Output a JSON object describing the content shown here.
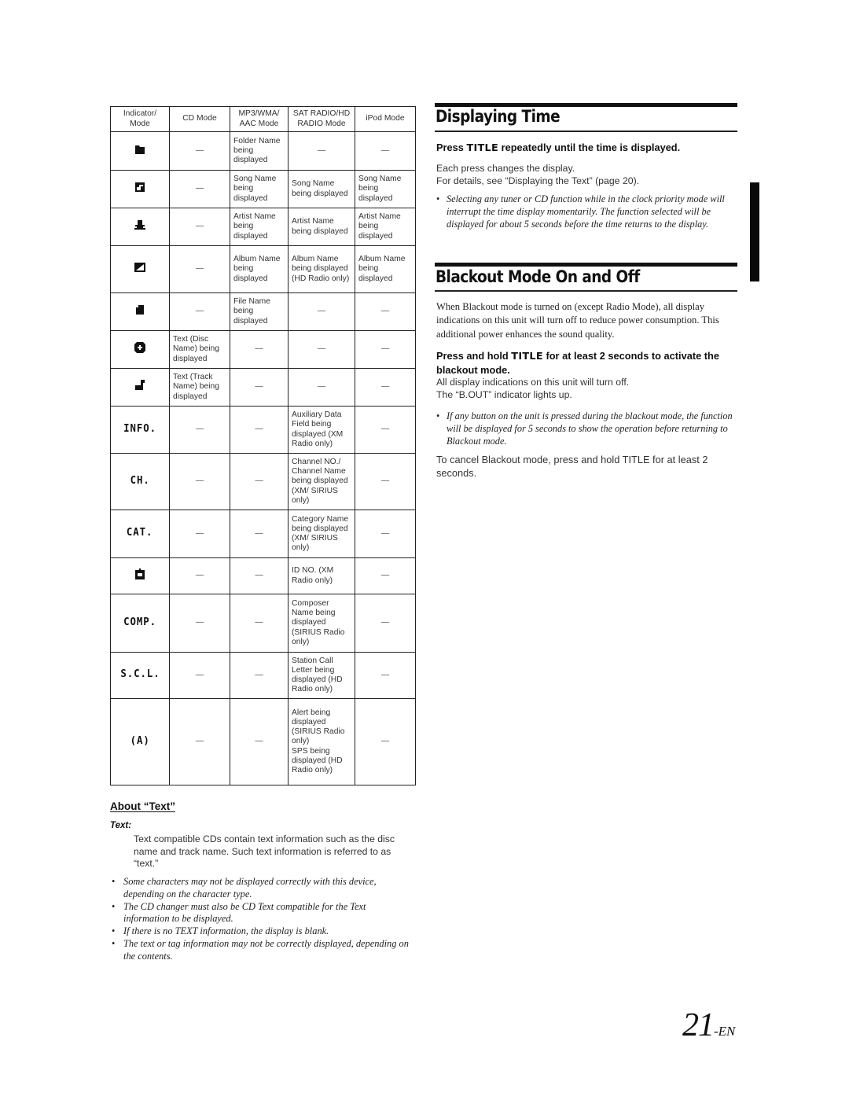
{
  "table": {
    "headers": [
      "Indicator/\nMode",
      "CD Mode",
      "MP3/WMA/\nAAC Mode",
      "SAT RADIO/HD\nRADIO Mode",
      "iPod Mode"
    ],
    "dash": "—",
    "rows": [
      {
        "indicator": {
          "type": "icon",
          "name": "folder-icon"
        },
        "cd": "—",
        "mp3": "Folder Name being displayed",
        "sat": "—",
        "ipod": "—"
      },
      {
        "indicator": {
          "type": "icon",
          "name": "song-icon"
        },
        "cd": "—",
        "mp3": "Song Name being displayed",
        "sat": "Song Name being displayed",
        "ipod": "Song Name being displayed"
      },
      {
        "indicator": {
          "type": "icon",
          "name": "artist-icon"
        },
        "cd": "—",
        "mp3": "Artist Name being displayed",
        "sat": "Artist Name being displayed",
        "ipod": "Artist Name being displayed"
      },
      {
        "indicator": {
          "type": "icon",
          "name": "album-icon"
        },
        "cd": "—",
        "mp3": "Album Name being displayed",
        "sat": "Album Name being displayed (HD Radio only)",
        "ipod": "Album Name being displayed"
      },
      {
        "indicator": {
          "type": "icon",
          "name": "file-icon"
        },
        "cd": "—",
        "mp3": "File Name being displayed",
        "sat": "—",
        "ipod": "—"
      },
      {
        "indicator": {
          "type": "icon",
          "name": "disc-icon"
        },
        "cd": "Text (Disc Name) being displayed",
        "mp3": "—",
        "sat": "—",
        "ipod": "—"
      },
      {
        "indicator": {
          "type": "icon",
          "name": "track-icon"
        },
        "cd": "Text (Track Name) being displayed",
        "mp3": "—",
        "sat": "—",
        "ipod": "—"
      },
      {
        "indicator": {
          "type": "lcd",
          "text": "INFO."
        },
        "cd": "—",
        "mp3": "—",
        "sat": "Auxiliary Data Field being displayed (XM Radio only)",
        "ipod": "—"
      },
      {
        "indicator": {
          "type": "lcd",
          "text": "CH."
        },
        "cd": "—",
        "mp3": "—",
        "sat": "Channel NO./ Channel Name being displayed (XM/ SIRIUS only)",
        "ipod": "—"
      },
      {
        "indicator": {
          "type": "lcd",
          "text": "CAT."
        },
        "cd": "—",
        "mp3": "—",
        "sat": "Category Name being displayed (XM/ SIRIUS only)",
        "ipod": "—"
      },
      {
        "indicator": {
          "type": "icon",
          "name": "id-icon"
        },
        "cd": "—",
        "mp3": "—",
        "sat": "ID NO. (XM Radio only)",
        "ipod": "—"
      },
      {
        "indicator": {
          "type": "lcd",
          "text": "COMP."
        },
        "cd": "—",
        "mp3": "—",
        "sat": "Composer Name being displayed (SIRIUS Radio only)",
        "ipod": "—"
      },
      {
        "indicator": {
          "type": "lcd",
          "text": "S.C.L."
        },
        "cd": "—",
        "mp3": "—",
        "sat": "Station Call Letter being displayed (HD Radio only)",
        "ipod": "—"
      },
      {
        "indicator": {
          "type": "lcd",
          "text": "(A)"
        },
        "cd": "—",
        "mp3": "—",
        "sat": "Alert being displayed (SIRIUS Radio only)\nSPS being displayed (HD Radio only)",
        "ipod": "—"
      }
    ]
  },
  "about_text": {
    "heading": "About “Text”",
    "label": "Text:",
    "body": "Text compatible CDs contain text information such as the disc name and track name. Such text information is referred to as “text.”",
    "notes": [
      "Some characters may not be displayed correctly with this device, depending on the character type.",
      "The CD changer must also be CD Text compatible for the Text information to be displayed.",
      "If there is no TEXT information, the display is blank.",
      "The text or tag information may not be correctly displayed, depending on the contents."
    ]
  },
  "displaying_time": {
    "title": "Displaying Time",
    "instruction_pre": "Press ",
    "instruction_key": "TITLE",
    "instruction_post": " repeatedly until the time is displayed.",
    "body_line1": "Each press changes the display.",
    "body_line2": "For details, see “Displaying the Text” (page 20).",
    "notes": [
      "Selecting any tuner or CD function while in the clock priority mode will interrupt the time display momentarily. The function selected will be displayed for about 5 seconds before the time returns to the display."
    ]
  },
  "blackout": {
    "title": "Blackout Mode On and Off",
    "intro": "When Blackout mode is turned on (except Radio Mode), all display indications on this unit will turn off to reduce power consumption. This additional power enhances the sound quality.",
    "instruction_pre": "Press and hold ",
    "instruction_key": "TITLE",
    "instruction_post": " for at least 2 seconds to activate the blackout mode.",
    "body_line1": "All display indications on this unit will turn off.",
    "body_line2": "The “B.OUT” indicator lights up.",
    "notes": [
      "If any button on the unit is pressed during the blackout mode, the function will be displayed for 5 seconds to show the operation before returning to Blackout mode."
    ],
    "cancel": "To cancel Blackout mode, press and hold TITLE for at least 2 seconds."
  },
  "page_number": {
    "number": "21",
    "suffix": "-EN"
  }
}
